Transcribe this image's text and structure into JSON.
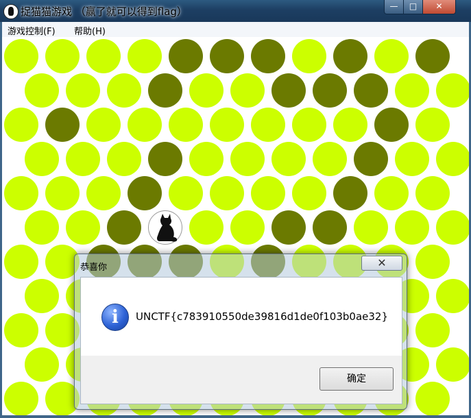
{
  "window": {
    "title": "捉猫猫游戏 （赢了就可以得到flag）",
    "minimize": "—",
    "maximize": "□",
    "close": "✕"
  },
  "menu": {
    "game": "游戏控制(F)",
    "help": "帮助(H)"
  },
  "board": {
    "rows": 11,
    "cols": 11,
    "open_color": "#ccff00",
    "blocked_color": "#6b7a00",
    "blocked": [
      [
        0,
        4
      ],
      [
        0,
        5
      ],
      [
        0,
        6
      ],
      [
        0,
        8
      ],
      [
        0,
        10
      ],
      [
        1,
        3
      ],
      [
        1,
        6
      ],
      [
        1,
        7
      ],
      [
        1,
        8
      ],
      [
        2,
        1
      ],
      [
        2,
        9
      ],
      [
        3,
        3
      ],
      [
        3,
        8
      ],
      [
        4,
        3
      ],
      [
        4,
        8
      ],
      [
        5,
        2
      ],
      [
        5,
        6
      ],
      [
        5,
        7
      ],
      [
        6,
        2
      ],
      [
        6,
        3
      ],
      [
        6,
        4
      ],
      [
        6,
        6
      ]
    ],
    "cat": [
      5,
      3
    ]
  },
  "dialog": {
    "title": "恭喜你",
    "close": "✕",
    "info_icon": "i",
    "message": "UNCTF{c783910550de39816d1de0f103b0ae32}",
    "ok_label": "确定"
  }
}
